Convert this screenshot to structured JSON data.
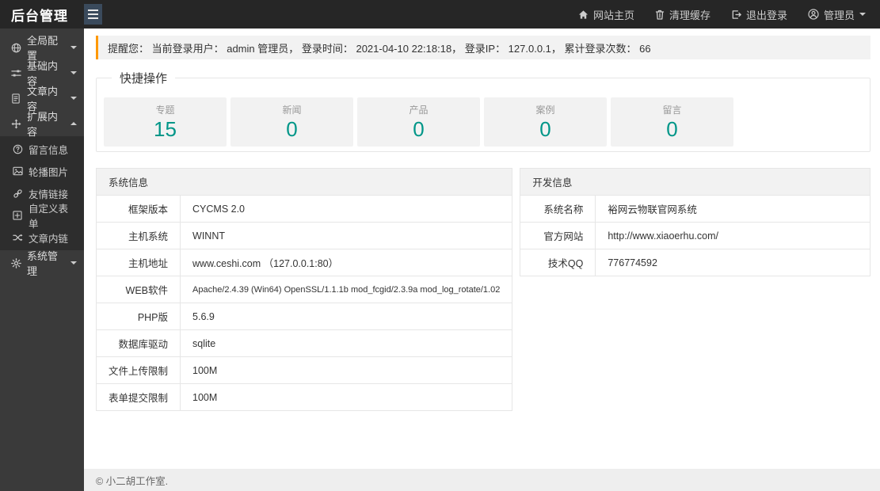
{
  "topbar": {
    "logo": "后台管理",
    "nav": [
      {
        "label": "网站主页",
        "icon": "home-icon"
      },
      {
        "label": "清理缓存",
        "icon": "trash-icon"
      },
      {
        "label": "退出登录",
        "icon": "logout-icon"
      },
      {
        "label": "管理员",
        "icon": "user-icon"
      }
    ]
  },
  "sidebar": {
    "items": [
      {
        "label": "全局配置",
        "icon": "globe-icon",
        "state": "collapsed"
      },
      {
        "label": "基础内容",
        "icon": "sliders-icon",
        "state": "collapsed"
      },
      {
        "label": "文章内容",
        "icon": "file-icon",
        "state": "collapsed"
      },
      {
        "label": "扩展内容",
        "icon": "arrows-icon",
        "state": "expanded",
        "children": [
          {
            "label": "留言信息",
            "icon": "question-circle-icon"
          },
          {
            "label": "轮播图片",
            "icon": "image-icon"
          },
          {
            "label": "友情链接",
            "icon": "link-icon"
          },
          {
            "label": "自定义表单",
            "icon": "table-plus-icon"
          },
          {
            "label": "文章内链",
            "icon": "shuffle-icon"
          }
        ]
      },
      {
        "label": "系统管理",
        "icon": "gear-icon",
        "state": "collapsed"
      }
    ]
  },
  "alert": {
    "text": "提醒您： 当前登录用户： admin 管理员， 登录时间： 2021-04-10 22:18:18， 登录IP： 127.0.0.1， 累计登录次数： 66"
  },
  "quick": {
    "legend": "快捷操作",
    "cards": [
      {
        "label": "专题",
        "value": "15"
      },
      {
        "label": "新闻",
        "value": "0"
      },
      {
        "label": "产品",
        "value": "0"
      },
      {
        "label": "案例",
        "value": "0"
      },
      {
        "label": "留言",
        "value": "0"
      }
    ]
  },
  "system_table": {
    "title": "系统信息",
    "rows": [
      {
        "label": "框架版本",
        "value": "CYCMS 2.0"
      },
      {
        "label": "主机系统",
        "value": "WINNT"
      },
      {
        "label": "主机地址",
        "value": "www.ceshi.com （127.0.0.1:80）"
      },
      {
        "label": "WEB软件",
        "value": "Apache/2.4.39 (Win64) OpenSSL/1.1.1b mod_fcgid/2.3.9a mod_log_rotate/1.02"
      },
      {
        "label": "PHP版",
        "value": "5.6.9"
      },
      {
        "label": "数据库驱动",
        "value": "sqlite"
      },
      {
        "label": "文件上传限制",
        "value": "100M"
      },
      {
        "label": "表单提交限制",
        "value": "100M"
      }
    ]
  },
  "dev_table": {
    "title": "开发信息",
    "rows": [
      {
        "label": "系统名称",
        "value": "裕网云物联官网系统"
      },
      {
        "label": "官方网站",
        "value": "http://www.xiaoerhu.com/"
      },
      {
        "label": "技术QQ",
        "value": "776774592"
      }
    ]
  },
  "footer": {
    "text": "© 小二胡工作室."
  },
  "colors": {
    "alert_accent": "#ff9900",
    "stat_number": "#009688",
    "topbar_bg": "#262626",
    "sidebar_bg": "#3a3a3a",
    "submenu_bg": "#2d2d2d",
    "burger_bg": "#3a4a5c"
  }
}
